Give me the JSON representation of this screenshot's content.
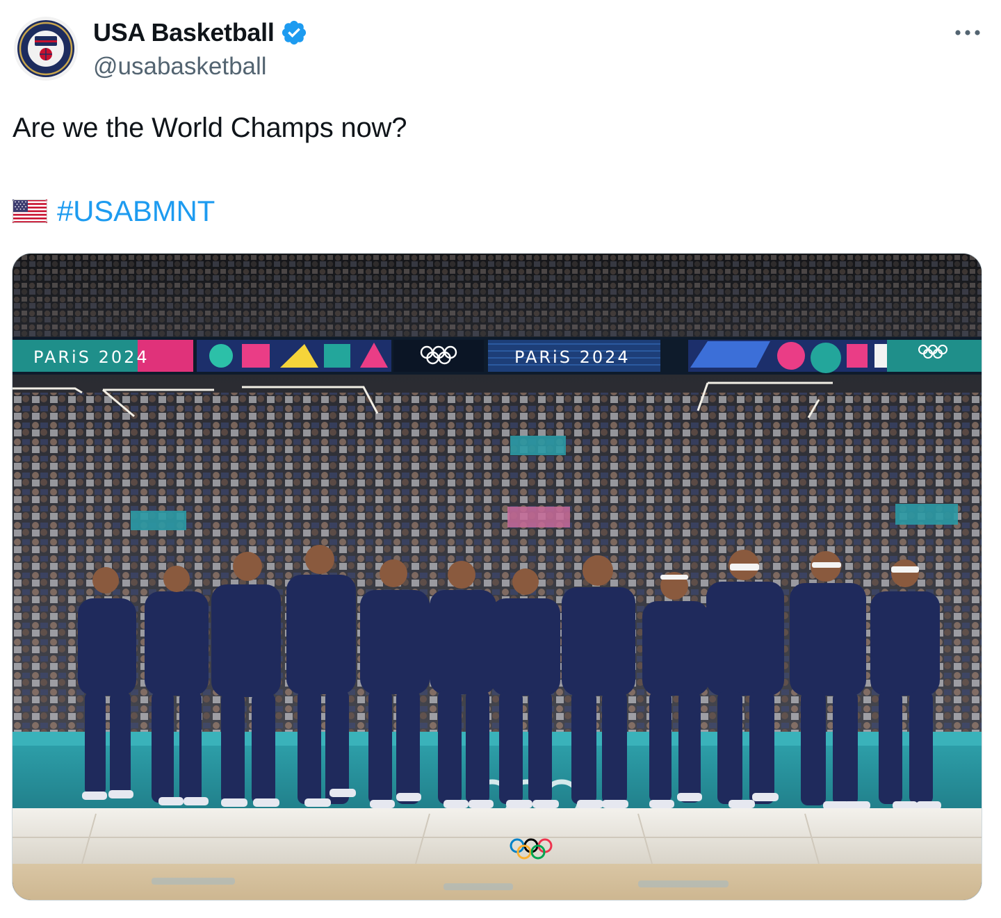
{
  "account": {
    "display_name": "USA Basketball",
    "handle": "@usabasketball",
    "verified": true,
    "avatar_icon": "usa-basketball-logo-icon"
  },
  "menu_icon": "more-options-icon",
  "tweet": {
    "text": "Are we the World Champs now?",
    "flag_emoji": "us-flag-icon",
    "hashtag": "#USABMNT"
  },
  "media": {
    "banner_left": "PARiS 2024",
    "banner_center": "PARiS 2024"
  },
  "colors": {
    "link": "#1d9bf0",
    "verified": "#1d9bf0",
    "secondary_text": "#536471",
    "uniform_navy": "#1f2a5c",
    "court_teal": "#2a9aa6"
  }
}
